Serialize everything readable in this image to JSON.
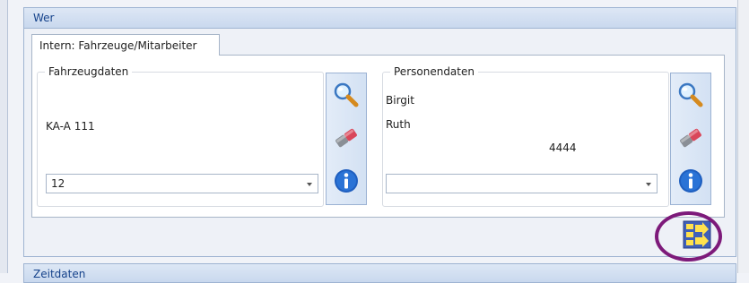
{
  "group": {
    "title": "Wer"
  },
  "tab": {
    "label": "Intern: Fahrzeuge/Mitarbeiter"
  },
  "fahrzeugdaten": {
    "legend": "Fahrzeugdaten",
    "kennzeichen": "KA-A 111",
    "combo_value": "12"
  },
  "personendaten": {
    "legend": "Personendaten",
    "vorname": "Birgit",
    "nachname": "Ruth",
    "nummer": "4444",
    "combo_value": ""
  },
  "buttons": {
    "search_icon": "magnifier-icon",
    "clear_icon": "eraser-icon",
    "info_icon": "info-icon",
    "transfer_icon": "transfer-arrows-icon"
  },
  "next_group": {
    "title": "Zeitdaten"
  },
  "colors": {
    "header_text": "#15428b",
    "highlight_ring": "#7d1a7a",
    "info_blue": "#1f5fbf"
  }
}
